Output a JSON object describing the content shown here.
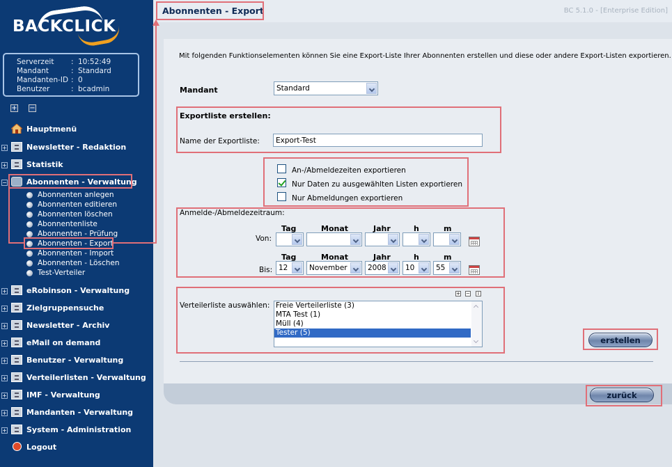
{
  "header": {
    "page_title": "Abonnenten - Export",
    "version": "BC 5.1.0 - [Enterprise Edition]"
  },
  "sidebar": {
    "logo_text": "BACKCLICK",
    "server_info": {
      "serverzeit_label": "Serverzeit",
      "serverzeit": "10:52:49",
      "mandant_label": "Mandant",
      "mandant": "Standard",
      "mandanten_id_label": "Mandanten-ID",
      "mandanten_id": "0",
      "benutzer_label": "Benutzer",
      "benutzer": "bcadmin",
      "separator": ":"
    },
    "expand_all": "+",
    "collapse_all": "−",
    "nav": [
      {
        "label": "Hauptmenü"
      },
      {
        "label": "Newsletter - Redaktion"
      },
      {
        "label": "Statistik"
      },
      {
        "label": "Abonnenten - Verwaltung"
      },
      {
        "label": "eRobinson - Verwaltung"
      },
      {
        "label": "Zielgruppensuche"
      },
      {
        "label": "Newsletter - Archiv"
      },
      {
        "label": "eMail on demand"
      },
      {
        "label": "Benutzer - Verwaltung"
      },
      {
        "label": "Verteilerlisten - Verwaltung"
      },
      {
        "label": "IMF - Verwaltung"
      },
      {
        "label": "Mandanten - Verwaltung"
      },
      {
        "label": "System - Administration"
      },
      {
        "label": "Logout"
      }
    ],
    "subnav": [
      {
        "label": "Abonnenten anlegen"
      },
      {
        "label": "Abonnenten editieren"
      },
      {
        "label": "Abonnenten löschen"
      },
      {
        "label": "Abonnentenliste"
      },
      {
        "label": "Abonnenten - Prüfung"
      },
      {
        "label": "Abonnenten - Export"
      },
      {
        "label": "Abonnenten - Import"
      },
      {
        "label": "Abonnenten - Löschen"
      },
      {
        "label": "Test-Verteiler"
      }
    ]
  },
  "main": {
    "intro": "Mit folgenden Funktionselementen können Sie eine Export-Liste Ihrer Abonnenten erstellen und diese oder andere Export-Listen exportieren.",
    "mandant_label": "Mandant",
    "mandant_value": "Standard",
    "exportliste_heading": "Exportliste erstellen:",
    "exportname_label": "Name der Exportliste:",
    "exportname_value": "Export-Test",
    "checkboxes": [
      {
        "label": "An-/Abmeldezeiten exportieren",
        "checked": false
      },
      {
        "label": "Nur Daten zu ausgewählten Listen exportieren",
        "checked": true
      },
      {
        "label": "Nur Abmeldungen exportieren",
        "checked": false
      }
    ],
    "zeitraum_label": "Anmelde-/Abmeldezeitraum:",
    "col_headers": {
      "tag": "Tag",
      "monat": "Monat",
      "jahr": "Jahr",
      "h": "h",
      "m": "m"
    },
    "von_label": "Von:",
    "bis_label": "Bis:",
    "von": {
      "tag": "",
      "monat": "",
      "jahr": "",
      "h": "",
      "m": ""
    },
    "bis": {
      "tag": "12",
      "monat": "November",
      "jahr": "2008",
      "h": "10",
      "m": "55"
    },
    "verteiler_label": "Verteilerliste auswählen:",
    "verteiler": [
      {
        "label": "Freie Verteilerliste (3)"
      },
      {
        "label": "MTA Test (1)"
      },
      {
        "label": "Müll (4)"
      },
      {
        "label": "Tester (5)"
      }
    ],
    "selected_verteiler": "Tester (5)",
    "list_tools": {
      "plus": "+",
      "minus": "−",
      "info": "i"
    },
    "erstellen_button": "erstellen",
    "zurueck_button": "zurück"
  },
  "colors": {
    "sidebar_bg": "#0c3a74",
    "highlight": "#e06f78",
    "selection": "#316ac5"
  }
}
